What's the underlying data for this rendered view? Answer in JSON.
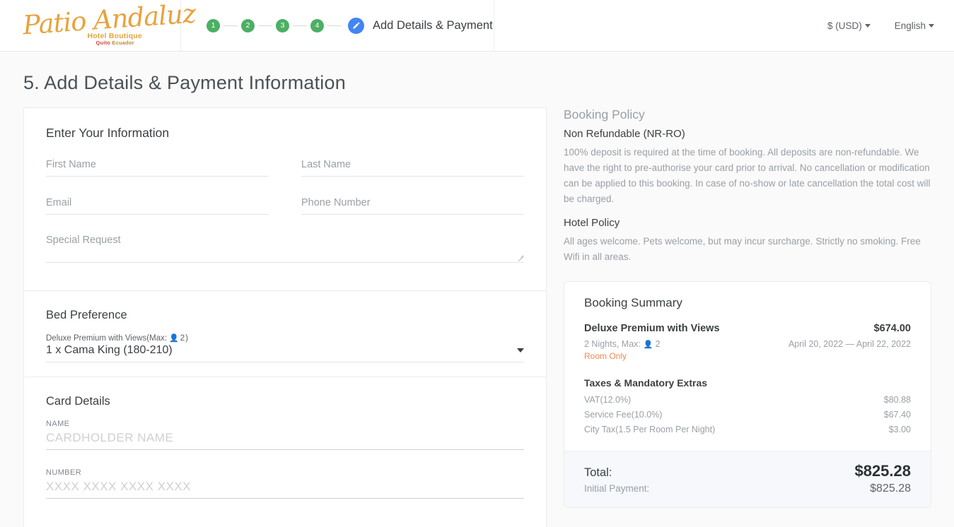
{
  "header": {
    "logo": {
      "script": "Patio Andaluz",
      "sub1": "Hotel Boutique",
      "city": "Quito",
      "country": "Ecuador"
    },
    "steps": [
      "1",
      "2",
      "3",
      "4"
    ],
    "current_step_label": "Add Details & Payment",
    "currency": "$ (USD)",
    "language": "English",
    "accent_blue": "#4285f4",
    "accent_green": "#4caf63"
  },
  "page": {
    "title": "5. Add Details & Payment Information"
  },
  "info_section": {
    "title": "Enter Your Information",
    "first_name_placeholder": "First Name",
    "last_name_placeholder": "Last Name",
    "email_placeholder": "Email",
    "phone_placeholder": "Phone Number",
    "special_request_placeholder": "Special Request",
    "first_name_value": "",
    "last_name_value": "",
    "email_value": "",
    "phone_value": "",
    "special_request_value": ""
  },
  "bed_section": {
    "title": "Bed Preference",
    "room_label": "Deluxe Premium with Views(Max:",
    "max_guests": "2",
    "room_label_close": ")",
    "selected": "1 x Cama King (180-210)"
  },
  "card_section": {
    "title": "Card Details",
    "name_label": "NAME",
    "name_placeholder": "CARDHOLDER NAME",
    "name_value": "",
    "number_label": "NUMBER",
    "number_placeholder": "XXXX XXXX XXXX XXXX",
    "number_value": ""
  },
  "policy": {
    "title": "Booking Policy",
    "rate_name": "Non Refundable (NR-RO)",
    "rate_text": "100% deposit is required at the time of booking. All deposits are non-refundable. We have the right to pre-authorise your card prior to arrival. No cancellation or modification can be applied to this booking. In case of no-show or late cancellation the total cost will be charged.",
    "hotel_title": "Hotel Policy",
    "hotel_text": "All ages welcome. Pets welcome, but may incur surcharge. Strictly no smoking. Free Wifi in all areas."
  },
  "summary": {
    "title": "Booking Summary",
    "room_name": "Deluxe Premium with Views",
    "room_price": "$674.00",
    "nights": "2 Nights,  Max:",
    "max_guests": "2",
    "dates": "April 20, 2022 — April 22, 2022",
    "board": "Room Only",
    "taxes_title": "Taxes & Mandatory Extras",
    "taxes": [
      {
        "label": "VAT(12.0%)",
        "amount": "$80.88"
      },
      {
        "label": "Service Fee(10.0%)",
        "amount": "$67.40"
      },
      {
        "label": "City Tax(1.5 Per Room Per Night)",
        "amount": "$3.00"
      }
    ],
    "total_label": "Total:",
    "total_value": "$825.28",
    "initial_label": "Initial Payment:",
    "initial_value": "$825.28",
    "board_color": "#f08a4b"
  }
}
